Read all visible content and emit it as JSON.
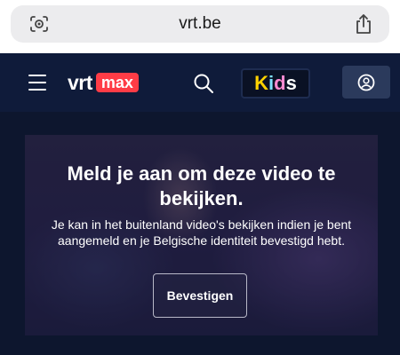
{
  "browser": {
    "url": "vrt.be",
    "icons": {
      "left": "visual-search-icon",
      "right": "share-icon"
    }
  },
  "header": {
    "menu_icon": "hamburger-menu-icon",
    "logo": {
      "vrt": "vrt",
      "max": "max"
    },
    "search_icon": "search-icon",
    "kids": {
      "k": "K",
      "i": "i",
      "d": "d",
      "s": "s"
    },
    "profile_icon": "user-profile-icon"
  },
  "player": {
    "title": "Meld je aan om deze video te bekijken.",
    "body": "Je kan in het buitenland video's bekijken indien je bent aangemeld en je Belgische identiteit bevestigd hebt.",
    "button_label": "Bevestigen"
  },
  "colors": {
    "header_bg": "#0f1b3a",
    "page_bg": "#0b1326",
    "brand_red": "#ff3c46",
    "profile_bg": "#2b3a5c"
  }
}
